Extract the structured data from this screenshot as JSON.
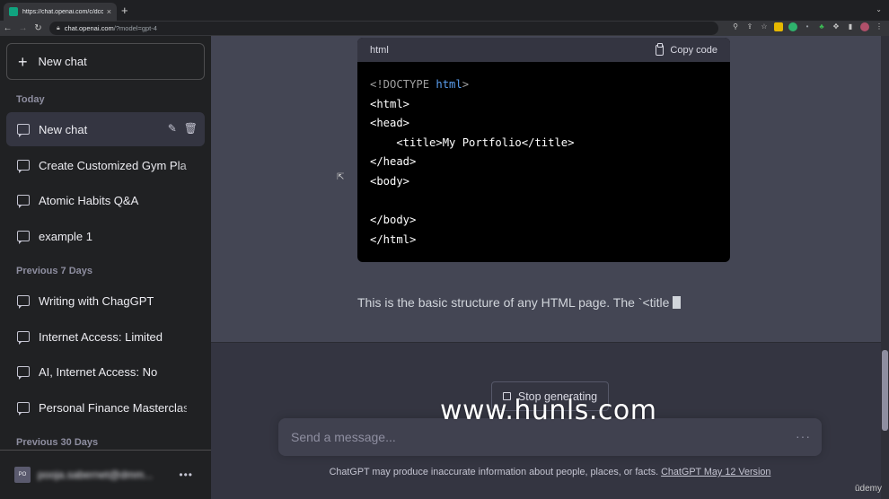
{
  "browser": {
    "tab_title": "https://chat.openai.com/c/dcc",
    "tab_close": "×",
    "new_tab": "+",
    "url_host": "chat.openai.com",
    "url_path": "/?model=gpt-4"
  },
  "sidebar": {
    "new_chat_label": "New chat",
    "sections": {
      "today": "Today",
      "previous_7_days": "Previous 7 Days",
      "previous_30_days": "Previous 30 Days"
    },
    "items": [
      {
        "label": "New chat",
        "active": true
      },
      {
        "label": "Create Customized Gym Plan"
      },
      {
        "label": "Atomic Habits Q&A"
      },
      {
        "label": "example 1"
      },
      {
        "label": "Writing with ChagGPT"
      },
      {
        "label": "Internet Access: Limited"
      },
      {
        "label": "AI, Internet Access: No"
      },
      {
        "label": "Personal Finance Masterclass"
      }
    ],
    "user": {
      "initials": "PO",
      "email": "pooja.sabernet@dmm..."
    }
  },
  "code_block": {
    "language": "html",
    "copy_label": "Copy code",
    "lines": {
      "l1_tag": "<!DOCTYPE ",
      "l1_kw": "html",
      "l1_end": ">",
      "l2": "<html>",
      "l3": "<head>",
      "l4": "    <title>My Portfolio</title>",
      "l5": "</head>",
      "l6": "<body>",
      "l7": "",
      "l8": "</body>",
      "l9": "</html>"
    }
  },
  "assistant_text": "This is the basic structure of any HTML page. The `<title",
  "stop_label": "Stop generating",
  "composer": {
    "placeholder": "Send a message..."
  },
  "disclaimer": {
    "text": "ChatGPT may produce inaccurate information about people, places, or facts. ",
    "link": "ChatGPT May 12 Version"
  },
  "watermark": "www.hunls.com",
  "udemy": "ūdemy"
}
